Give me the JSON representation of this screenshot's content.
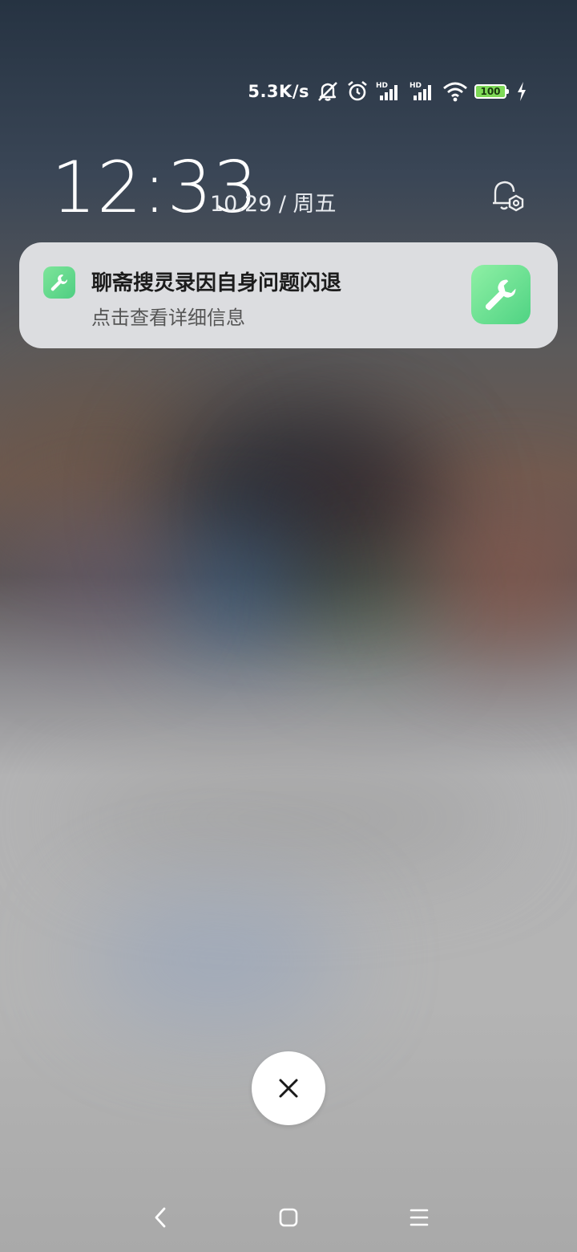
{
  "status_bar": {
    "net_speed": "5.3K/s",
    "icons": [
      "mute-icon",
      "alarm-icon",
      "hd-signal-icon",
      "hd-signal-icon",
      "wifi-icon",
      "battery-icon",
      "charging-icon"
    ],
    "hd_label": "HD",
    "battery_level": "100",
    "battery_color": "#7ed957"
  },
  "lock_screen": {
    "time": "12:33",
    "date": "10.29 / 周五"
  },
  "notification": {
    "title": "聊斋搜灵录因自身问题闪退",
    "body": "点击查看详细信息",
    "icon": "wrench-icon",
    "accent_color": "#5ad68a"
  },
  "controls": {
    "close_icon": "close-icon"
  },
  "nav_bar": {
    "items": [
      "back-icon",
      "home-icon",
      "menu-icon"
    ]
  }
}
